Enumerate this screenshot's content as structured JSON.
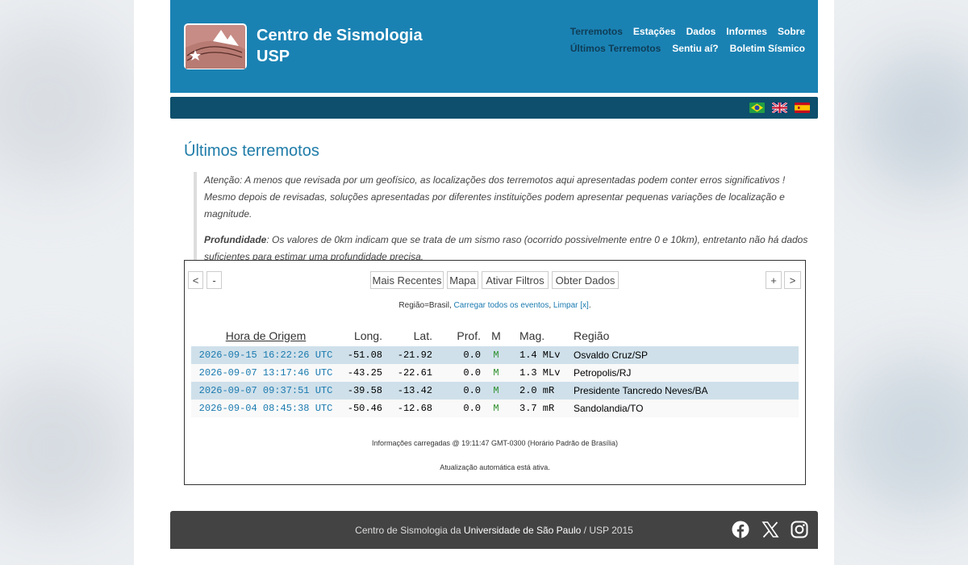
{
  "site": {
    "title_line1": "Centro de Sismologia",
    "title_line2": "USP"
  },
  "nav": {
    "primary": [
      "Terremotos",
      "Estações",
      "Dados",
      "Informes",
      "Sobre"
    ],
    "secondary": [
      "Últimos Terremotos",
      "Sentiu aí?",
      "Boletim Sísmico"
    ],
    "active_primary": "Terremotos",
    "active_secondary": "Últimos Terremotos"
  },
  "languages": [
    "Português (Brasil)",
    "English",
    "Español"
  ],
  "page": {
    "title": "Últimos terremotos",
    "notice_warning": "Atenção: A menos que revisada por um geofísico, as localizações dos terremotos aqui apresentadas podem conter erros significativos ! Mesmo depois de revisadas, soluções apresentadas por diferentes instituições podem apresentar pequenas variações de localização e magnitude.",
    "depth_label": "Profundidade",
    "depth_text": ": Os valores de 0km indicam que se trata de um sismo raso (ocorrido possivelmente entre 0 e 10km), entretanto não há dados suficientes para estimar uma profundidade precisa."
  },
  "toolbar": {
    "prev": "<",
    "minus": "-",
    "recent": "Mais Recentes",
    "map": "Mapa",
    "filters": "Ativar Filtros",
    "data": "Obter Dados",
    "plus": "+",
    "next": ">"
  },
  "filter": {
    "region_text": "Região=Brasil, ",
    "load_all": "Carregar todos os eventos",
    "sep": ", ",
    "clear": "Limpar [x]",
    "end": "."
  },
  "table": {
    "headers": [
      "Hora de Origem",
      "Long.",
      "Lat.",
      "Prof.",
      "M",
      "Mag.",
      "Região"
    ],
    "rows": [
      {
        "time": "2026-09-15 16:22:26 UTC",
        "lon": "-51.08",
        "lat": "-21.92",
        "depth": "0.0",
        "m": "M",
        "mag": "1.4 MLv",
        "region": "Osvaldo Cruz/SP"
      },
      {
        "time": "2026-09-07 13:17:46 UTC",
        "lon": "-43.25",
        "lat": "-22.61",
        "depth": "0.0",
        "m": "M",
        "mag": "1.3 MLv",
        "region": "Petropolis/RJ"
      },
      {
        "time": "2026-09-07 09:37:51 UTC",
        "lon": "-39.58",
        "lat": "-13.42",
        "depth": "0.0",
        "m": "M",
        "mag": "2.0 mR",
        "region": "Presidente Tancredo Neves/BA"
      },
      {
        "time": "2026-09-04 08:45:38 UTC",
        "lon": "-50.46",
        "lat": "-12.68",
        "depth": "0.0",
        "m": "M",
        "mag": "3.7 mR",
        "region": "Sandolandia/TO"
      }
    ]
  },
  "status": {
    "loaded": "Informações carregadas @ 19:11:47 GMT-0300 (Horário Padrão de Brasília)",
    "auto_update": "Atualização automática está ativa."
  },
  "footer": {
    "prefix": "Centro de Sismologia da ",
    "university": "Universidade de São Paulo",
    "suffix": " / USP 2015",
    "social_icons": [
      "facebook-icon",
      "x-icon",
      "instagram-icon"
    ]
  },
  "colors": {
    "header": "#1a82b3",
    "subbar": "#0d4f6c",
    "title": "#1f7ca8",
    "link": "#1a7ab0",
    "row_highlight": "#cfe0ea",
    "footer": "#434343"
  }
}
